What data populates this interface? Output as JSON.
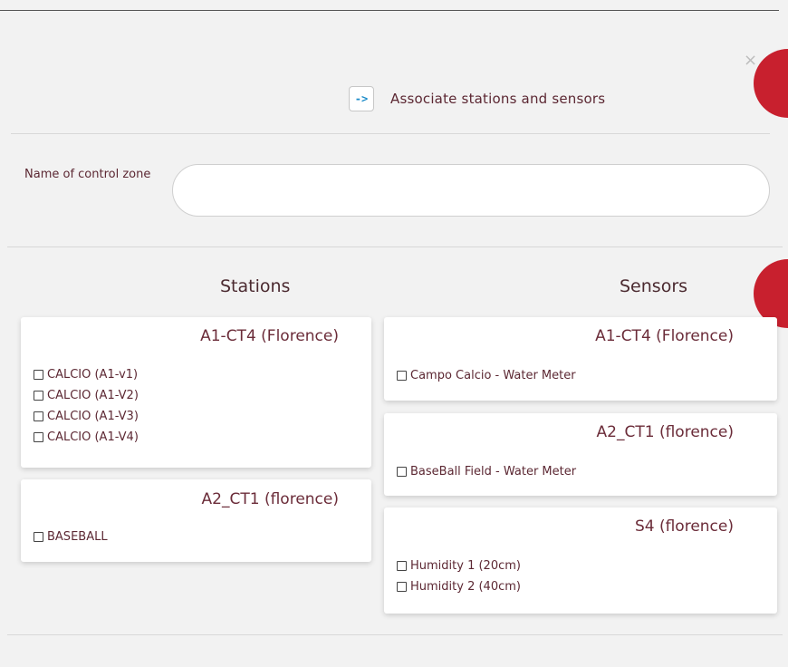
{
  "header": {
    "close_label": "×",
    "arrow_label": "->",
    "title": "Associate stations and sensors"
  },
  "zone": {
    "label": "Name of control zone",
    "value": "",
    "placeholder": ""
  },
  "stations": {
    "title": "Stations",
    "groups": [
      {
        "name": "A1-CT4 (Florence)",
        "items": [
          "CALCIO (A1-v1)",
          "CALCIO (A1-V2)",
          "CALCIO (A1-V3)",
          "CALCIO (A1-V4)"
        ]
      },
      {
        "name": "A2_CT1 (florence)",
        "items": [
          "BASEBALL"
        ]
      }
    ]
  },
  "sensors": {
    "title": "Sensors",
    "groups": [
      {
        "name": "A1-CT4 (Florence)",
        "items": [
          "Campo Calcio - Water Meter"
        ]
      },
      {
        "name": "A2_CT1 (florence)",
        "items": [
          "BaseBall Field - Water Meter"
        ]
      },
      {
        "name": "S4 (florence)",
        "items": [
          "Humidity 1 (20cm)",
          "Humidity 2 (40cm)"
        ]
      }
    ]
  },
  "colors": {
    "accent_red": "#c8202e",
    "text": "#6b2c39",
    "arrow_blue": "#1c8cc9"
  }
}
